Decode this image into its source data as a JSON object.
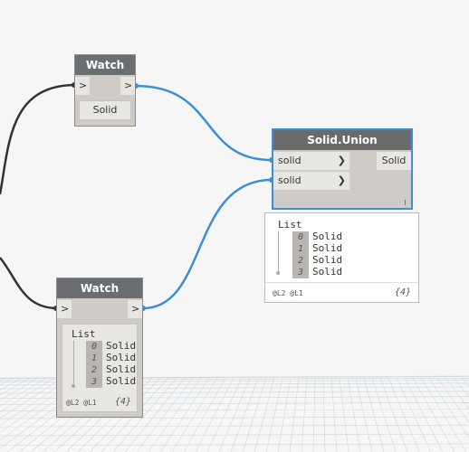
{
  "nodes": {
    "watch_top": {
      "title": "Watch",
      "in_port": ">",
      "out_port": ">",
      "value": "Solid"
    },
    "watch_bottom": {
      "title": "Watch",
      "in_port": ">",
      "out_port": ">",
      "list_header": "List",
      "items": [
        {
          "index": "0",
          "value": "Solid"
        },
        {
          "index": "1",
          "value": "Solid"
        },
        {
          "index": "2",
          "value": "Solid"
        },
        {
          "index": "3",
          "value": "Solid"
        }
      ],
      "levels": "@L2 @L1",
      "count": "{4}"
    },
    "solid_union": {
      "title": "Solid.Union",
      "input1": "solid",
      "input2": "solid",
      "output": "Solid",
      "preview": {
        "list_header": "List",
        "items": [
          {
            "index": "0",
            "value": "Solid"
          },
          {
            "index": "1",
            "value": "Solid"
          },
          {
            "index": "2",
            "value": "Solid"
          },
          {
            "index": "3",
            "value": "Solid"
          }
        ],
        "levels": "@L2 @L1",
        "count": "{4}"
      }
    }
  },
  "colors": {
    "wire_blue": "#3c8fd6",
    "wire_dark": "#333333",
    "header": "#6b6b6b",
    "selected_border": "#3c8fd6"
  }
}
